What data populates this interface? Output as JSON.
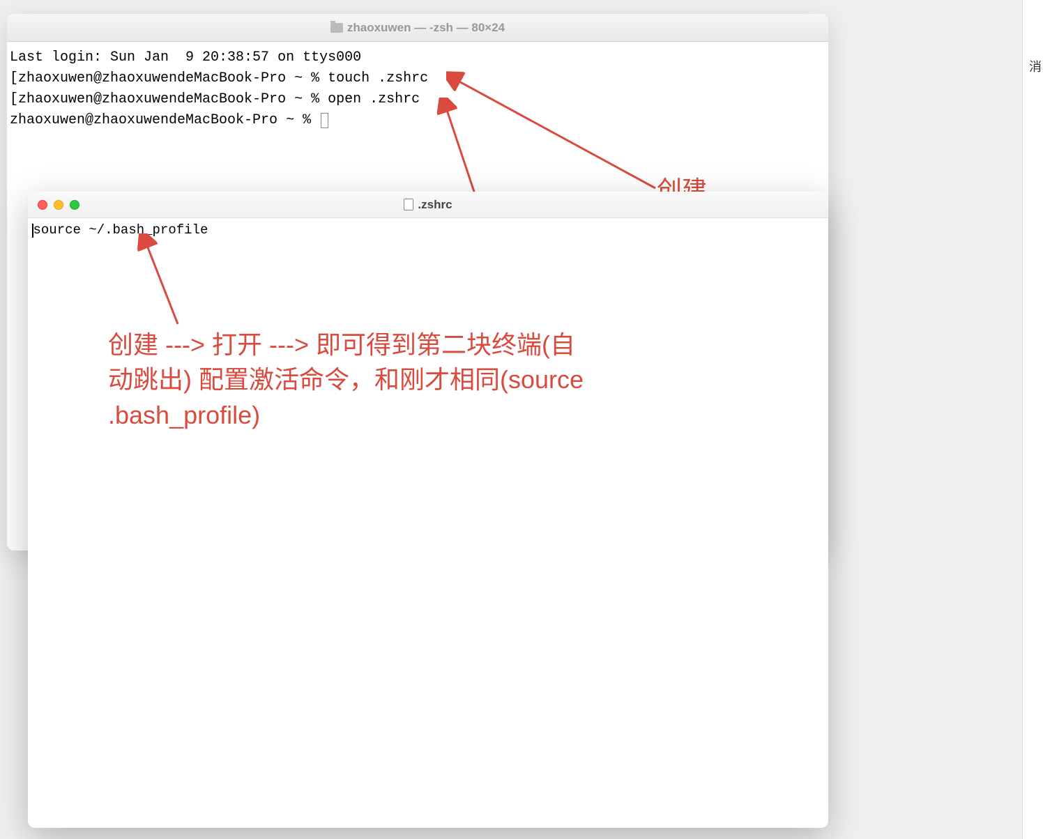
{
  "terminal": {
    "title": "zhaoxuwen — -zsh — 80×24",
    "lines": {
      "login": "Last login: Sun Jan  9 20:38:57 on ttys000",
      "line1": "[zhaoxuwen@zhaoxuwendeMacBook-Pro ~ % touch .zshrc",
      "line2": "[zhaoxuwen@zhaoxuwendeMacBook-Pro ~ % open .zshrc",
      "line3": "zhaoxuwen@zhaoxuwendeMacBook-Pro ~ % "
    }
  },
  "editor": {
    "title": ".zshrc",
    "content": "source ~/.bash_profile"
  },
  "annotations": {
    "create": "创建",
    "open": "打开",
    "explanation": "创建 ---> 打开 ---> 即可得到第二块终端(自动跳出) 配置激活命令，和刚才相同(source .bash_profile)"
  },
  "partial_text": "消"
}
